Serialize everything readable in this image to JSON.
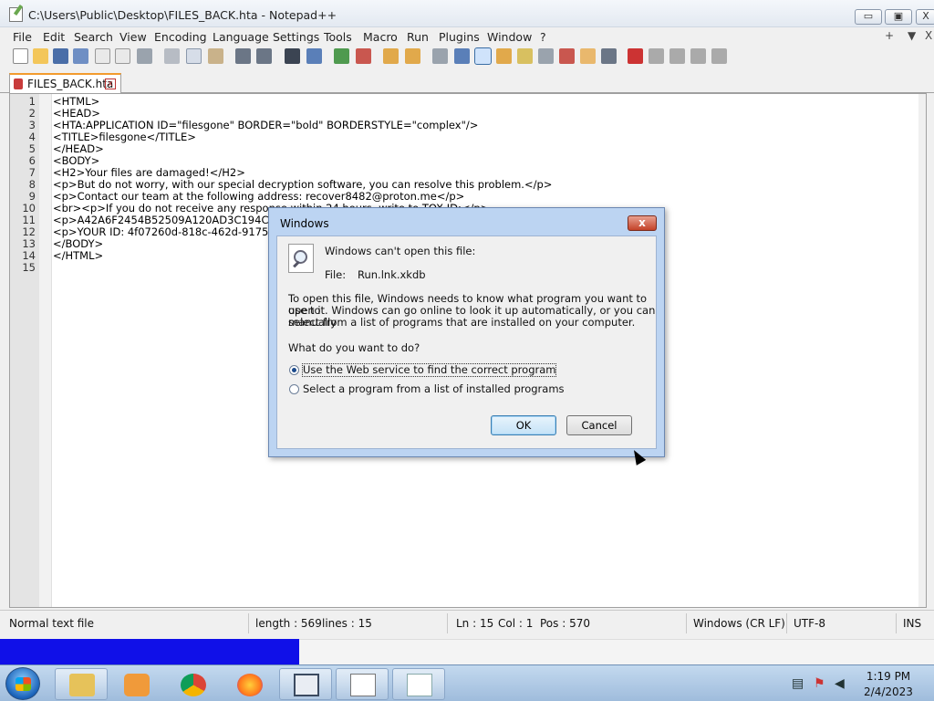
{
  "window": {
    "title": "C:\\Users\\Public\\Desktop\\FILES_BACK.hta - Notepad++",
    "minimize": "▭",
    "maximize": "▣",
    "close": "X"
  },
  "menu": {
    "items": [
      "File",
      "Edit",
      "Search",
      "View",
      "Encoding",
      "Language",
      "Settings",
      "Tools",
      "Macro",
      "Run",
      "Plugins",
      "Window",
      "?"
    ],
    "right": [
      "+",
      "▼",
      "X"
    ]
  },
  "tab": {
    "label": "FILES_BACK.hta",
    "close": "x"
  },
  "editor": {
    "line_numbers": [
      "1",
      "2",
      "3",
      "4",
      "5",
      "6",
      "7",
      "8",
      "9",
      "10",
      "11",
      "12",
      "13",
      "14",
      "15"
    ],
    "lines": [
      "<HTML>",
      "<HEAD>",
      "<HTA:APPLICATION ID=\"filesgone\" BORDER=\"bold\" BORDERSTYLE=\"complex\"/>",
      "<TITLE>filesgone</TITLE>",
      "</HEAD>",
      "<BODY>",
      "<H2>Your files are damaged!</H2>",
      "<p>But do not worry, with our special decryption software, you can resolve this problem.</p>",
      "<p>Contact our team at the following address: recover8482@proton.me</p>",
      "<br><p>If you do not receive any response within 24 hours, write to TOX ID:</p>",
      "<p>A42A6F2454B52509A120AD3C194CD",
      "<p>YOUR ID: 4f07260d-818c-462d-9175",
      "</BODY>",
      "</HTML>",
      ""
    ]
  },
  "status": {
    "filetype": "Normal text file",
    "length": "length : 569",
    "lines": "lines : 15",
    "ln": "Ln : 15",
    "col": "Col : 1",
    "pos": "Pos : 570",
    "eol": "Windows (CR LF)",
    "encoding": "UTF-8",
    "mode": "INS"
  },
  "dialog": {
    "title": "Windows",
    "close": "x",
    "heading": "Windows can't open this file:",
    "file_label": "File:",
    "file_name": "Run.lnk.xkdb",
    "description_1": "To open this file, Windows needs to know what program you want to use to",
    "description_2": "open it. Windows can go online to look it up automatically, or you can manually",
    "description_3": "select from a list of programs that are installed on your computer.",
    "question": "What do you want to do?",
    "option_web": "Use the Web service to find the correct program",
    "option_list": "Select a program from a list of installed programs",
    "ok": "OK",
    "cancel": "Cancel"
  },
  "taskbar": {
    "apps": [
      "explorer-icon",
      "media-player-icon",
      "chrome-icon",
      "firefox-icon",
      "window-app-icon",
      "notepad-plus-plus-icon",
      "blank-document-icon"
    ],
    "time": "1:19 PM",
    "date": "2/4/2023"
  }
}
